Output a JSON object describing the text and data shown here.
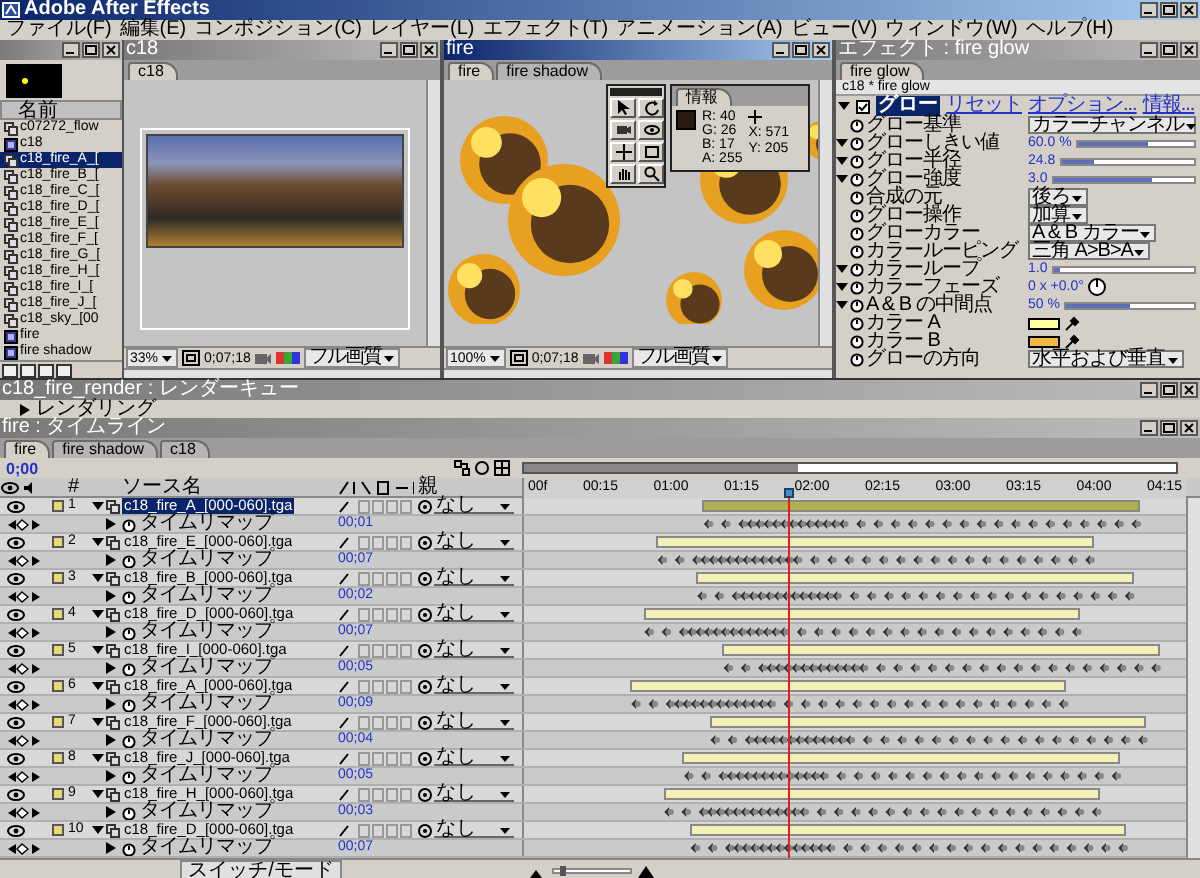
{
  "window": {
    "title": "Adobe After Effects"
  },
  "menu": [
    "ファイル(F)",
    "編集(E)",
    "コンポジション(C)",
    "レイヤー(L)",
    "エフェクト(T)",
    "アニメーション(A)",
    "ビュー(V)",
    "ウィンドウ(W)",
    "ヘルプ(H)"
  ],
  "project": {
    "header": "名前",
    "items": [
      {
        "name": "c07272_flow",
        "kind": "sequence",
        "selected": false
      },
      {
        "name": "c18",
        "kind": "comp",
        "selected": false
      },
      {
        "name": "c18_fire_A_[",
        "kind": "sequence",
        "selected": true
      },
      {
        "name": "c18_fire_B_[",
        "kind": "sequence",
        "selected": false
      },
      {
        "name": "c18_fire_C_[",
        "kind": "sequence",
        "selected": false
      },
      {
        "name": "c18_fire_D_[",
        "kind": "sequence",
        "selected": false
      },
      {
        "name": "c18_fire_E_[",
        "kind": "sequence",
        "selected": false
      },
      {
        "name": "c18_fire_F_[",
        "kind": "sequence",
        "selected": false
      },
      {
        "name": "c18_fire_G_[",
        "kind": "sequence",
        "selected": false
      },
      {
        "name": "c18_fire_H_[",
        "kind": "sequence",
        "selected": false
      },
      {
        "name": "c18_fire_I_[",
        "kind": "sequence",
        "selected": false
      },
      {
        "name": "c18_fire_J_[",
        "kind": "sequence",
        "selected": false
      },
      {
        "name": "c18_sky_[00",
        "kind": "sequence",
        "selected": false
      },
      {
        "name": "fire",
        "kind": "comp",
        "selected": false
      },
      {
        "name": "fire shadow",
        "kind": "comp",
        "selected": false
      }
    ]
  },
  "comps": [
    {
      "title": "c18",
      "kind": "scene",
      "tabs": [
        {
          "label": "c18",
          "selected": true
        }
      ],
      "zoom": "33%",
      "time": "0;07;18",
      "quality": "フル画質"
    },
    {
      "title": "fire",
      "kind": "explosions",
      "tabs": [
        {
          "label": "fire",
          "selected": true
        },
        {
          "label": "fire shadow",
          "selected": false
        }
      ],
      "zoom": "100%",
      "time": "0;07;18",
      "quality": "フル画質"
    }
  ],
  "info": {
    "tab": "情報",
    "color": "#2a1a10",
    "lines": [
      {
        "label": "R:",
        "value": "40"
      },
      {
        "label": "G:",
        "value": "26"
      },
      {
        "label": "B:",
        "value": "17"
      },
      {
        "label": "A:",
        "value": "255"
      }
    ],
    "position": [
      {
        "label": "X:",
        "value": "571"
      },
      {
        "label": "Y:",
        "value": "205"
      }
    ]
  },
  "effects": {
    "title": "エフェクト : fire glow",
    "tabs": [
      {
        "label": "fire glow",
        "selected": true
      }
    ],
    "path": "c18 * fire glow",
    "effect": {
      "name": "グロー",
      "links": [
        "リセット",
        "オプション...",
        "情報..."
      ]
    },
    "params": [
      {
        "kind": "dropdown",
        "label": "グロー基準",
        "value": "カラーチャンネル"
      },
      {
        "kind": "slider",
        "label": "グローしきい値",
        "value": "60.0 %",
        "level": 0.6
      },
      {
        "kind": "slider",
        "label": "グロー半径",
        "value": "24.8",
        "level": 0.25
      },
      {
        "kind": "slider",
        "label": "グロー強度",
        "value": "3.0",
        "level": 0.7
      },
      {
        "kind": "dropdown",
        "label": "合成の元",
        "value": "後ろ"
      },
      {
        "kind": "dropdown",
        "label": "グロー操作",
        "value": "加算"
      },
      {
        "kind": "dropdown",
        "label": "グローカラー",
        "value": "A & B カラー"
      },
      {
        "kind": "dropdown",
        "label": "カラールーピング",
        "value": "三角 A>B>A"
      },
      {
        "kind": "slider",
        "label": "カラーループ",
        "value": "1.0",
        "level": 0.05
      },
      {
        "kind": "dial",
        "label": "カラーフェーズ",
        "value": "0 x +0.0°"
      },
      {
        "kind": "slider",
        "label": "A & B の中間点",
        "value": "50 %",
        "level": 0.5
      },
      {
        "kind": "color",
        "label": "カラー A",
        "color": "#ffffa0"
      },
      {
        "kind": "color",
        "label": "カラー B",
        "color": "#f0b840"
      },
      {
        "kind": "dropdown",
        "label": "グローの方向",
        "value": "水平および垂直"
      }
    ]
  },
  "render_queue": {
    "title": "c18_fire_render : レンダーキュー",
    "item": "レンダリング"
  },
  "timeline": {
    "title": "fire : タイムライン",
    "tabs": [
      {
        "label": "fire",
        "selected": true
      },
      {
        "label": "fire shadow",
        "selected": false
      },
      {
        "label": "c18",
        "selected": false
      }
    ],
    "time": "0;00",
    "columns": [
      "#",
      "ソース名",
      "親"
    ],
    "ruler": [
      "00f",
      "00:15",
      "01:00",
      "01:15",
      "02:00",
      "02:15",
      "03:00",
      "03:15",
      "04:00",
      "04:15"
    ],
    "current_time": {
      "level": 0.4
    },
    "layers": [
      {
        "number": "1",
        "name": "c18_fire_A_[000-060].tga",
        "selected": true,
        "parent": "なし",
        "property": "タイムリマップ",
        "value": "00;01"
      },
      {
        "number": "2",
        "name": "c18_fire_E_[000-060].tga",
        "selected": false,
        "parent": "なし",
        "property": "タイムリマップ",
        "value": "00;07"
      },
      {
        "number": "3",
        "name": "c18_fire_B_[000-060].tga",
        "selected": false,
        "parent": "なし",
        "property": "タイムリマップ",
        "value": "00;02"
      },
      {
        "number": "4",
        "name": "c18_fire_D_[000-060].tga",
        "selected": false,
        "parent": "なし",
        "property": "タイムリマップ",
        "value": "00;07"
      },
      {
        "number": "5",
        "name": "c18_fire_I_[000-060].tga",
        "selected": false,
        "parent": "なし",
        "property": "タイムリマップ",
        "value": "00;05"
      },
      {
        "number": "6",
        "name": "c18_fire_A_[000-060].tga",
        "selected": false,
        "parent": "なし",
        "property": "タイムリマップ",
        "value": "00;09"
      },
      {
        "number": "7",
        "name": "c18_fire_F_[000-060].tga",
        "selected": false,
        "parent": "なし",
        "property": "タイムリマップ",
        "value": "00;04"
      },
      {
        "number": "8",
        "name": "c18_fire_J_[000-060].tga",
        "selected": false,
        "parent": "なし",
        "property": "タイムリマップ",
        "value": "00;05"
      },
      {
        "number": "9",
        "name": "c18_fire_H_[000-060].tga",
        "selected": false,
        "parent": "なし",
        "property": "タイムリマップ",
        "value": "00;03"
      },
      {
        "number": "10",
        "name": "c18_fire_D_[000-060].tga",
        "selected": false,
        "parent": "なし",
        "property": "タイムリマップ",
        "value": "00;07"
      }
    ],
    "mode_button": "スイッチ/モード",
    "zoom": {
      "level": 0.1
    }
  }
}
